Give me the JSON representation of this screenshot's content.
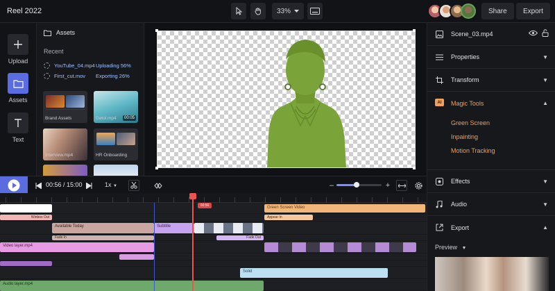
{
  "app": {
    "title": "Reel 2022"
  },
  "toolbar": {
    "zoom": "33%"
  },
  "header": {
    "share_label": "Share",
    "export_label": "Export"
  },
  "rail": [
    {
      "label": "Upload",
      "icon": "plus-icon"
    },
    {
      "label": "Assets",
      "icon": "folder-icon",
      "active": true
    },
    {
      "label": "Text",
      "icon": "text-icon"
    }
  ],
  "assets": {
    "title": "Assets",
    "recent_label": "Recent",
    "recent": [
      {
        "file": "YouTube_04.mp4",
        "status": "Uploading 56%"
      },
      {
        "file": "First_cut.mov",
        "status": "Exporting 26%"
      }
    ],
    "cards": [
      {
        "name": "Brand Assets"
      },
      {
        "name": "Detol.mp4",
        "duration": "00:05"
      },
      {
        "name": "Interview.mp4"
      },
      {
        "name": "HR Onboarding"
      }
    ]
  },
  "inspector": {
    "selected_file": "Scene_03.mp4",
    "sections": {
      "properties": "Properties",
      "transform": "Transform",
      "magic_badge": "AI",
      "magic": "Magic Tools",
      "effects": "Effects",
      "audio": "Audio",
      "export": "Export"
    },
    "magic_items": [
      "Green Screen",
      "Inpainting",
      "Motion Tracking"
    ],
    "preview_label": "Preview"
  },
  "transport": {
    "time": "00:56 / 15:00",
    "speed": "1x",
    "zoom_level": 0.45
  },
  "timeline": {
    "playhead_label": "00:56",
    "clips": {
      "green_screen": "Green Screen Video",
      "appear": "Appear In",
      "available": "Available Today",
      "fade_in": "Fade In",
      "video_layer": "Video layer.mp4",
      "solid": "Solid",
      "audio": "Audio layer.mp4",
      "winbox": "Winbox Out",
      "fade_out": "Fade Out",
      "subtitle": "Subtitle"
    }
  },
  "colors": {
    "accent": "#5b6ce0",
    "orange": "#f0a25c",
    "green_screen": "#7aa33a"
  }
}
